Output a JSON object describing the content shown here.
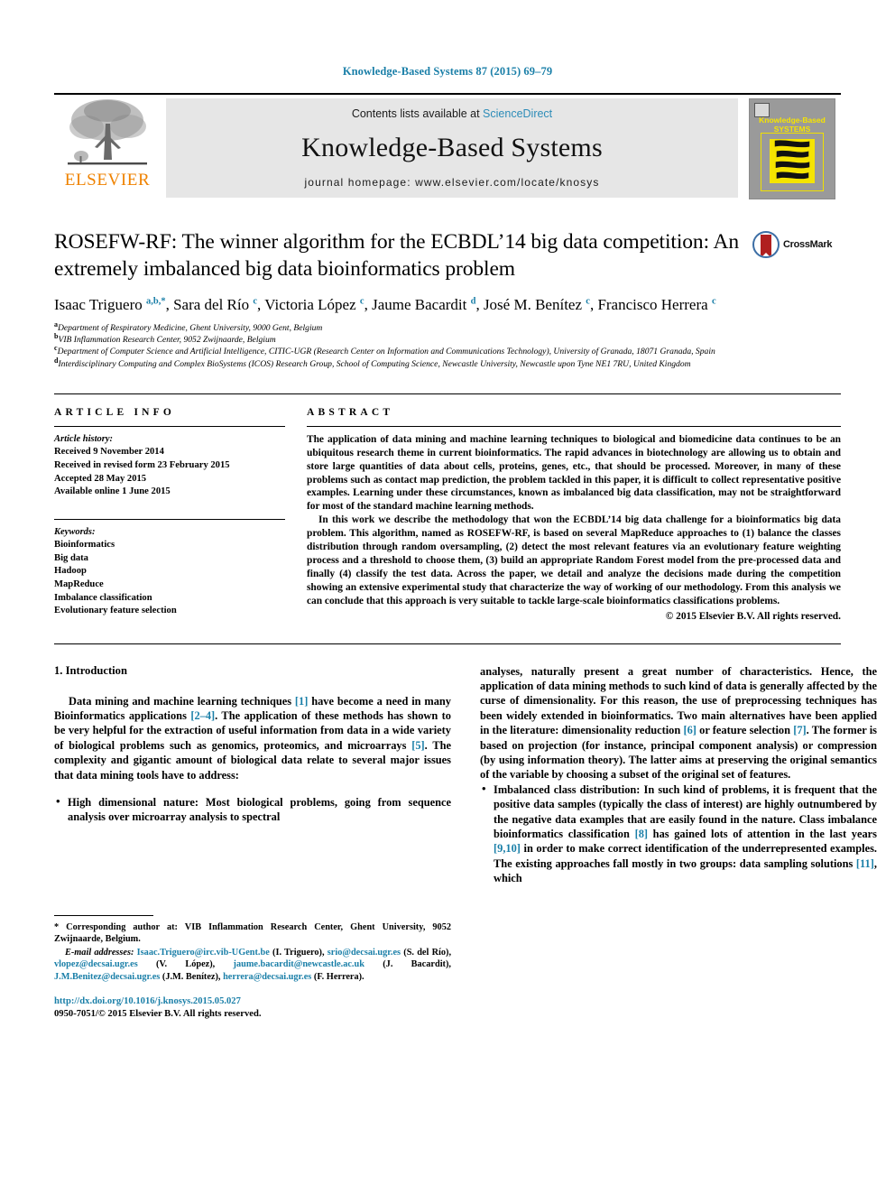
{
  "running_head": "Knowledge-Based Systems 87 (2015) 69–79",
  "masthead": {
    "contents_prefix": "Contents lists available at ",
    "sciencedirect": "ScienceDirect",
    "journal_title": "Knowledge-Based Systems",
    "homepage": "journal homepage: www.elsevier.com/locate/knosys",
    "publisher_logo_text": "ELSEVIER",
    "cover_title_line1": "Knowledge-Based",
    "cover_title_line2": "SYSTEMS"
  },
  "article": {
    "title": "ROSEFW-RF: The winner algorithm for the ECBDL’14 big data competition: An extremely imbalanced big data bioinformatics problem",
    "crossmark_label": "CrossMark",
    "authors_html": "Isaac Triguero <sup>a,b,</sup><sup>*</sup>, Sara del Río <sup>c</sup>, Victoria López <sup>c</sup>, Jaume Bacardit <sup>d</sup>, José M. Benítez <sup>c</sup>, Francisco Herrera <sup>c</sup>",
    "affiliations": [
      {
        "mark": "a",
        "text": "Department of Respiratory Medicine, Ghent University, 9000 Gent, Belgium"
      },
      {
        "mark": "b",
        "text": "VIB Inflammation Research Center, 9052 Zwijnaarde, Belgium"
      },
      {
        "mark": "c",
        "text": "Department of Computer Science and Artificial Intelligence, CITIC-UGR (Research Center on Information and Communications Technology), University of Granada, 18071 Granada, Spain"
      },
      {
        "mark": "d",
        "text": "Interdisciplinary Computing and Complex BioSystems (ICOS) Research Group, School of Computing Science, Newcastle University, Newcastle upon Tyne NE1 7RU, United Kingdom"
      }
    ]
  },
  "article_info": {
    "heading": "ARTICLE INFO",
    "history_label": "Article history:",
    "history": [
      "Received 9 November 2014",
      "Received in revised form 23 February 2015",
      "Accepted 28 May 2015",
      "Available online 1 June 2015"
    ],
    "keywords_label": "Keywords:",
    "keywords": [
      "Bioinformatics",
      "Big data",
      "Hadoop",
      "MapReduce",
      "Imbalance classification",
      "Evolutionary feature selection"
    ]
  },
  "abstract": {
    "heading": "ABSTRACT",
    "paragraph1": "The application of data mining and machine learning techniques to biological and biomedicine data continues to be an ubiquitous research theme in current bioinformatics. The rapid advances in biotechnology are allowing us to obtain and store large quantities of data about cells, proteins, genes, etc., that should be processed. Moreover, in many of these problems such as contact map prediction, the problem tackled in this paper, it is difficult to collect representative positive examples. Learning under these circumstances, known as imbalanced big data classification, may not be straightforward for most of the standard machine learning methods.",
    "paragraph2": "In this work we describe the methodology that won the ECBDL’14 big data challenge for a bioinformatics big data problem. This algorithm, named as ROSEFW-RF, is based on several MapReduce approaches to (1) balance the classes distribution through random oversampling, (2) detect the most relevant features via an evolutionary feature weighting process and a threshold to choose them, (3) build an appropriate Random Forest model from the pre-processed data and finally (4) classify the test data. Across the paper, we detail and analyze the decisions made during the competition showing an extensive experimental study that characterize the way of working of our methodology. From this analysis we can conclude that this approach is very suitable to tackle large-scale bioinformatics classifications problems.",
    "copyright": "© 2015 Elsevier B.V. All rights reserved."
  },
  "introduction": {
    "heading": "1. Introduction",
    "para1_a": "Data mining and machine learning techniques ",
    "para1_ref1": "[1]",
    "para1_b": " have become a need in many Bioinformatics applications ",
    "para1_ref2": "[2–4]",
    "para1_c": ". The application of these methods has shown to be very helpful for the extraction of useful information from data in a wide variety of biological problems such as genomics, proteomics, and microarrays ",
    "para1_ref3": "[5]",
    "para1_d": ". The complexity and gigantic amount of biological data relate to several major issues that data mining tools have to address:",
    "bullet1_lead": "High dimensional nature",
    "bullet1_text": ": Most biological problems, going from sequence analysis over microarray analysis to spectral analyses, naturally present a great number of characteristics. Hence, the application of data mining methods to such kind of data is generally affected by the curse of dimensionality. For this reason, the use of preprocessing techniques has been widely extended in bioinformatics. Two main alternatives have been applied in the literature: dimensionality reduction ",
    "bullet1_ref1": "[6]",
    "bullet1_text2": " or feature selection ",
    "bullet1_ref2": "[7]",
    "bullet1_text3": ". The former is based on projection (for instance, principal component analysis) or compression (by using information theory). The latter aims at preserving the original semantics of the variable by choosing a subset of the original set of features.",
    "bullet2_lead": "Imbalanced class distribution",
    "bullet2_text": ": In such kind of problems, it is frequent that the positive data samples (typically the class of interest) are highly outnumbered by the negative data examples that are easily found in the nature. Class imbalance bioinformatics classification ",
    "bullet2_ref1": "[8]",
    "bullet2_text2": " has gained lots of attention in the last years ",
    "bullet2_ref2": "[9,10]",
    "bullet2_text3": " in order to make correct identification of the underrepresented examples. The existing approaches fall mostly in two groups: data sampling solutions ",
    "bullet2_ref3": "[11]",
    "bullet2_text4": ", which"
  },
  "footnote": {
    "star": "*",
    "corresponding": " Corresponding author at: VIB Inflammation Research Center, Ghent University, 9052 Zwijnaarde, Belgium.",
    "email_label": "E-mail addresses:",
    "emails": [
      {
        "addr": "Isaac.Triguero@irc.vib-UGent.be",
        "name": " (I. Triguero), "
      },
      {
        "addr": "srio@decsai.ugr.es",
        "name": " (S. del Río), "
      },
      {
        "addr": "vlopez@decsai.ugr.es",
        "name": " (V. López), "
      },
      {
        "addr": "jaume.bacardit@newcastle.ac.uk",
        "name": " (J. Bacardit), "
      },
      {
        "addr": "J.M.Benitez@decsai.ugr.es",
        "name": " (J.M. Benítez), "
      },
      {
        "addr": "herrera@decsai.ugr.es",
        "name": " (F. Herrera)."
      }
    ],
    "doi": "http://dx.doi.org/10.1016/j.knosys.2015.05.027",
    "issn_line": "0950-7051/© 2015 Elsevier B.V. All rights reserved."
  },
  "colors": {
    "link_blue": "#1a7fa8",
    "sciencedirect_blue": "#2d8cb8",
    "elsevier_orange": "#ef8200",
    "masthead_grey": "#e6e6e6",
    "cover_yellow": "#f5e400",
    "crossmark_red": "#b02020"
  }
}
